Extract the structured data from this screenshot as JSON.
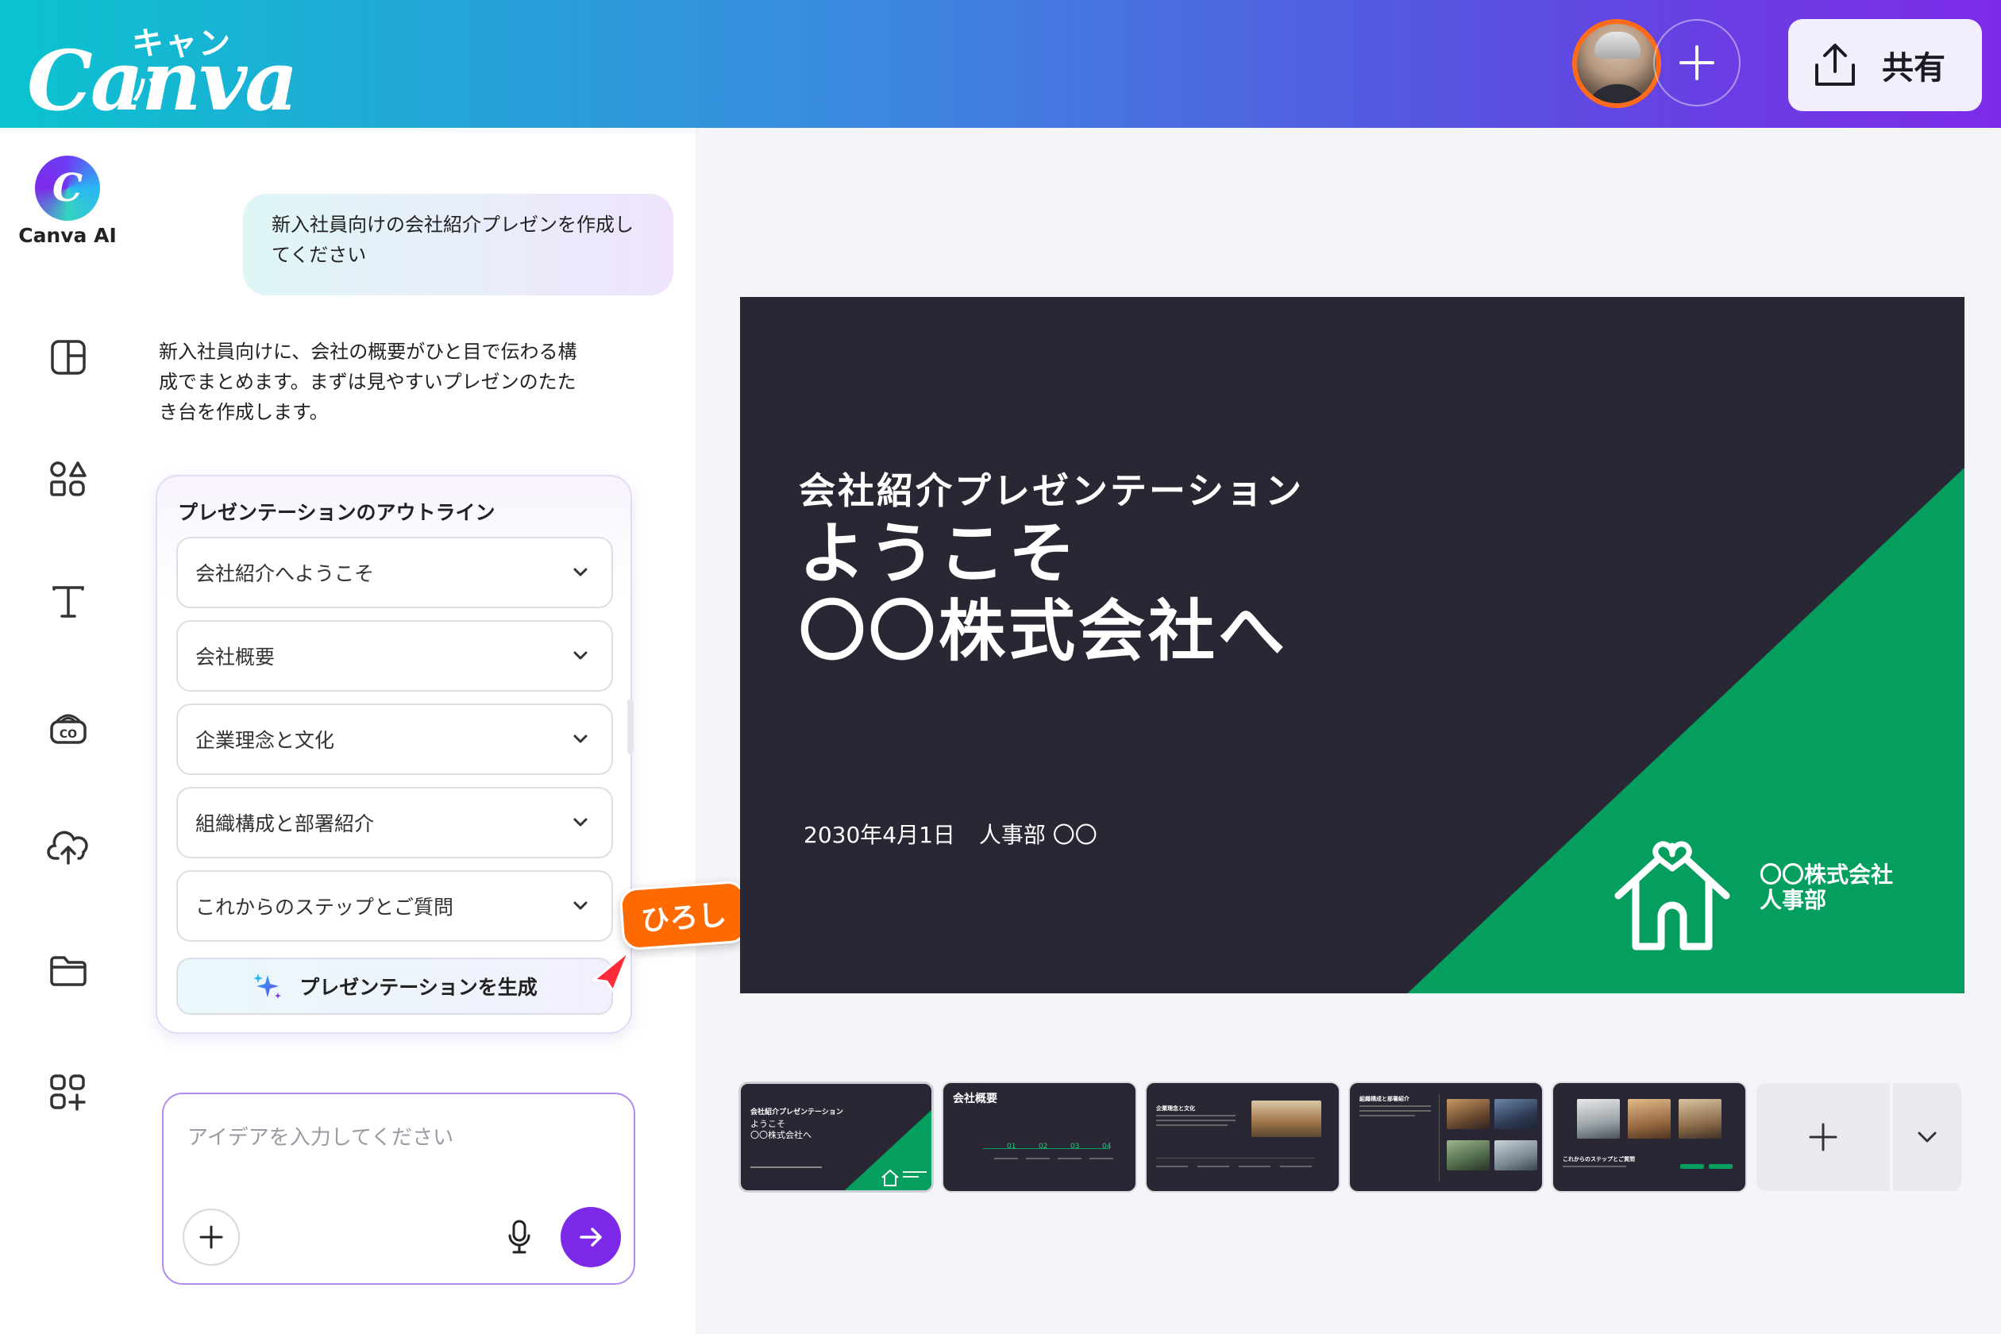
{
  "header": {
    "brand_kana": "キャンバ",
    "brand_word": "Canva",
    "share_label": "共有"
  },
  "rail": {
    "ai_label": "Canva AI"
  },
  "chat": {
    "user_message": "新入社員向けの会社紹介プレゼンを作成してください",
    "ai_reply": "新入社員向けに、会社の概要がひと目で伝わる構成でまとめます。まずは見やすいプレゼンのたたき台を作成します。",
    "outline_title": "プレゼンテーションのアウトライン",
    "outline_items": [
      "会社紹介へようこそ",
      "会社概要",
      "企業理念と文化",
      "組織構成と部署紹介",
      "これからのステップとご質問"
    ],
    "generate_label": "プレゼンテーションを生成",
    "cursor_name": "ひろし",
    "input_placeholder": "アイデアを入力してください"
  },
  "slide": {
    "subtitle": "会社紹介プレゼンテーション",
    "headline_line1": "ようこそ",
    "headline_line2": "〇〇株式会社へ",
    "date": "2030年4月1日",
    "department": "人事部 〇〇",
    "company_line1": "〇〇株式会社",
    "company_line2": "人事部",
    "background_color": "#282733",
    "accent_color": "#049e5f"
  },
  "thumbnails": [
    {
      "title": "会社紹介プレゼンテーション",
      "line2": "ようこそ",
      "line3": "〇〇株式会社へ"
    },
    {
      "title": "会社概要",
      "steps": [
        "01",
        "02",
        "03",
        "04"
      ]
    },
    {
      "title": "企業理念と文化"
    },
    {
      "title": "組織構成と部署紹介"
    },
    {
      "title": "これからのステップとご質問"
    }
  ],
  "colors": {
    "accent_purple": "#7d2ae8",
    "cursor_orange": "#ff6a00"
  }
}
